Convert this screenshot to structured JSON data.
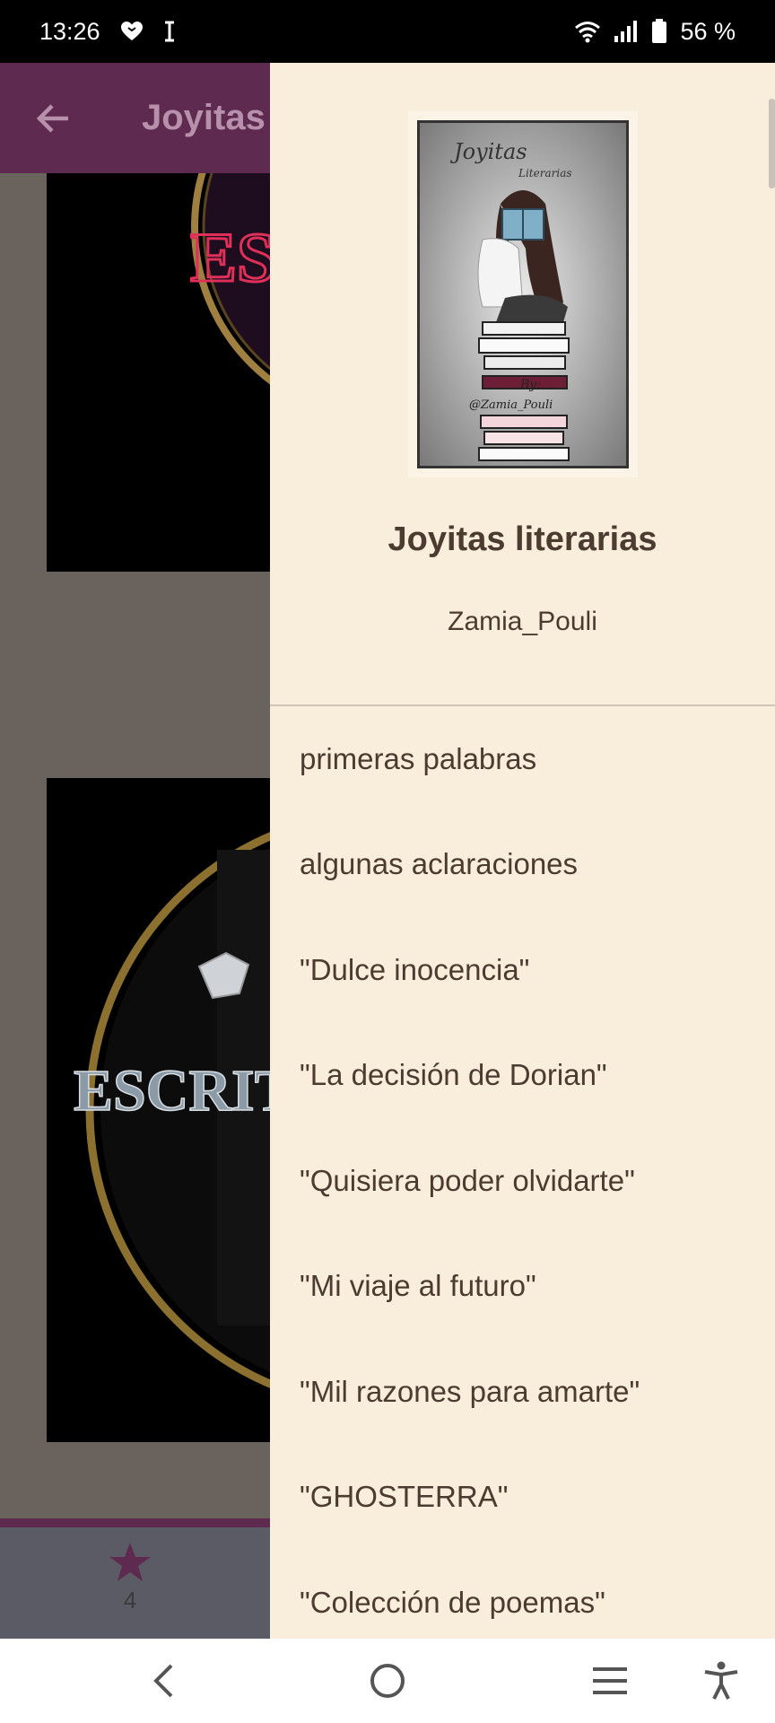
{
  "status_bar": {
    "time": "13:26",
    "left_icons": [
      "heart-shield-icon",
      "text-cursor-icon"
    ],
    "right_icons": [
      "wifi-icon",
      "signal-icon",
      "battery-icon"
    ],
    "battery": "56 %"
  },
  "app": {
    "toolbar_title": "Joyitas literarias",
    "images": [
      {
        "text": "ESCRITORES"
      },
      {
        "text": "ESCRITORES"
      }
    ],
    "bottom_bar": {
      "vote_icon": "star-icon",
      "vote_count": "4"
    },
    "colors": {
      "toolbar": "#5e2a50",
      "accent": "#5e2a50"
    }
  },
  "drawer": {
    "cover": {
      "title": "Joyitas",
      "subtitle": "Literarias",
      "by": "By:",
      "handle": "@Zamia_Pouli"
    },
    "title": "Joyitas literarias",
    "author": "Zamia_Pouli",
    "chapters": [
      "primeras palabras",
      "algunas aclaraciones",
      "\"Dulce inocencia\"",
      "\"La decisión de Dorian\"",
      "\"Quisiera poder olvidarte\"",
      "\"Mi viaje al futuro\"",
      "\"Mil razones para amarte\"",
      "\"GHOSTERRA\"",
      "\"Colección de poemas\""
    ],
    "colors": {
      "background": "#f9eedb",
      "text": "#4c3b30"
    }
  },
  "nav_bar": {
    "icons": [
      "back-icon",
      "home-icon",
      "recents-icon",
      "accessibility-icon"
    ]
  }
}
